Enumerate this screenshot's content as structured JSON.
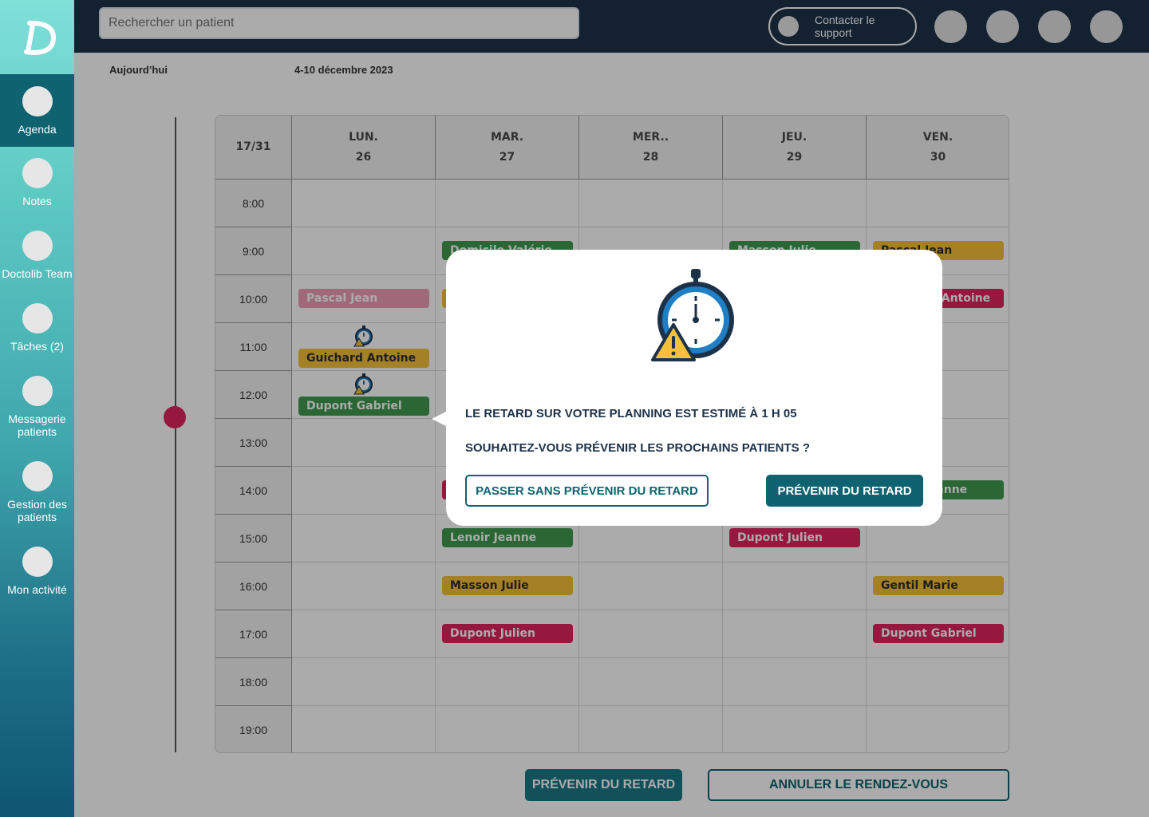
{
  "app": {
    "logo_letter": "D"
  },
  "sidebar": {
    "items": [
      {
        "label": "Agenda",
        "active": true
      },
      {
        "label": "Notes"
      },
      {
        "label": "Doctolib Team"
      },
      {
        "label": "Tâches (2)"
      },
      {
        "label": "Messagerie patients"
      },
      {
        "label": "Gestion des patients"
      },
      {
        "label": "Mon activité"
      }
    ]
  },
  "topbar": {
    "search_placeholder": "Rechercher un patient",
    "support_label": "Contacter le support"
  },
  "calendar": {
    "today_label": "Aujourd’hui",
    "range_label": "4-10 décembre 2023",
    "corner_label": "17/31",
    "days": [
      {
        "name": "LUN.",
        "num": "26"
      },
      {
        "name": "MAR.",
        "num": "27"
      },
      {
        "name": "MER..",
        "num": "28"
      },
      {
        "name": "JEU.",
        "num": "29"
      },
      {
        "name": "VEN.",
        "num": "30"
      }
    ],
    "hours": [
      "8:00",
      "9:00",
      "10:00",
      "11:00",
      "12:00",
      "13:00",
      "14:00",
      "15:00",
      "16:00",
      "17:00",
      "18:00",
      "19:00"
    ],
    "appointments": [
      {
        "name": "Domicile Valérie",
        "day": 1,
        "hour": "9:00",
        "color": "green"
      },
      {
        "name": "Masson Julie",
        "day": 3,
        "hour": "9:00",
        "color": "green"
      },
      {
        "name": "Pascal Jean",
        "day": 4,
        "hour": "9:00",
        "color": "yellow"
      },
      {
        "name": "Pascal Jean",
        "day": 0,
        "hour": "10:00",
        "color": "pink"
      },
      {
        "name": "",
        "day": 1,
        "hour": "10:00",
        "color": "yellow"
      },
      {
        "name": "Guichard Antoine",
        "day": 4,
        "hour": "10:00",
        "color": "magenta"
      },
      {
        "name": "Guichard Antoine",
        "day": 0,
        "hour": "11:00",
        "color": "yellow",
        "late": true
      },
      {
        "name": "Dupont Gabriel",
        "day": 0,
        "hour": "12:00",
        "color": "green",
        "late": true
      },
      {
        "name": "",
        "day": 1,
        "hour": "14:00",
        "color": "magenta"
      },
      {
        "name": "Lenoir Jeanne",
        "day": 4,
        "hour": "14:00",
        "color": "green"
      },
      {
        "name": "Lenoir Jeanne",
        "day": 1,
        "hour": "15:00",
        "color": "green"
      },
      {
        "name": "Dupont Julien",
        "day": 3,
        "hour": "15:00",
        "color": "magenta"
      },
      {
        "name": "Masson Julie",
        "day": 1,
        "hour": "16:00",
        "color": "yellow"
      },
      {
        "name": "Gentil Marie",
        "day": 4,
        "hour": "16:00",
        "color": "yellow"
      },
      {
        "name": "Dupont Julien",
        "day": 1,
        "hour": "17:00",
        "color": "magenta"
      },
      {
        "name": "Dupont Gabriel",
        "day": 4,
        "hour": "17:00",
        "color": "magenta"
      }
    ]
  },
  "bottom_actions": {
    "notify_label": "PRÉVENIR DU RETARD",
    "cancel_label": "ANNULER LE RENDEZ-VOUS"
  },
  "modal": {
    "icon": "stopwatch-warning-icon",
    "line1": "LE RETARD SUR VOTRE PLANNING EST ESTIMÉ À 1 H 05",
    "line2": "SOUHAITEZ-VOUS PRÉVENIR LES PROCHAINS PATIENTS  ?",
    "skip_label": "PASSER SANS PRÉVENIR DU RETARD",
    "notify_label": "PRÉVENIR DU RETARD"
  },
  "colors": {
    "primary": "#0f6270",
    "topbar": "#1d3249",
    "accent": "#e0245e",
    "appt_green": "#3f9a4f",
    "appt_yellow": "#f5c13b",
    "appt_pink": "#ee9db7",
    "appt_magenta": "#e0245e"
  }
}
